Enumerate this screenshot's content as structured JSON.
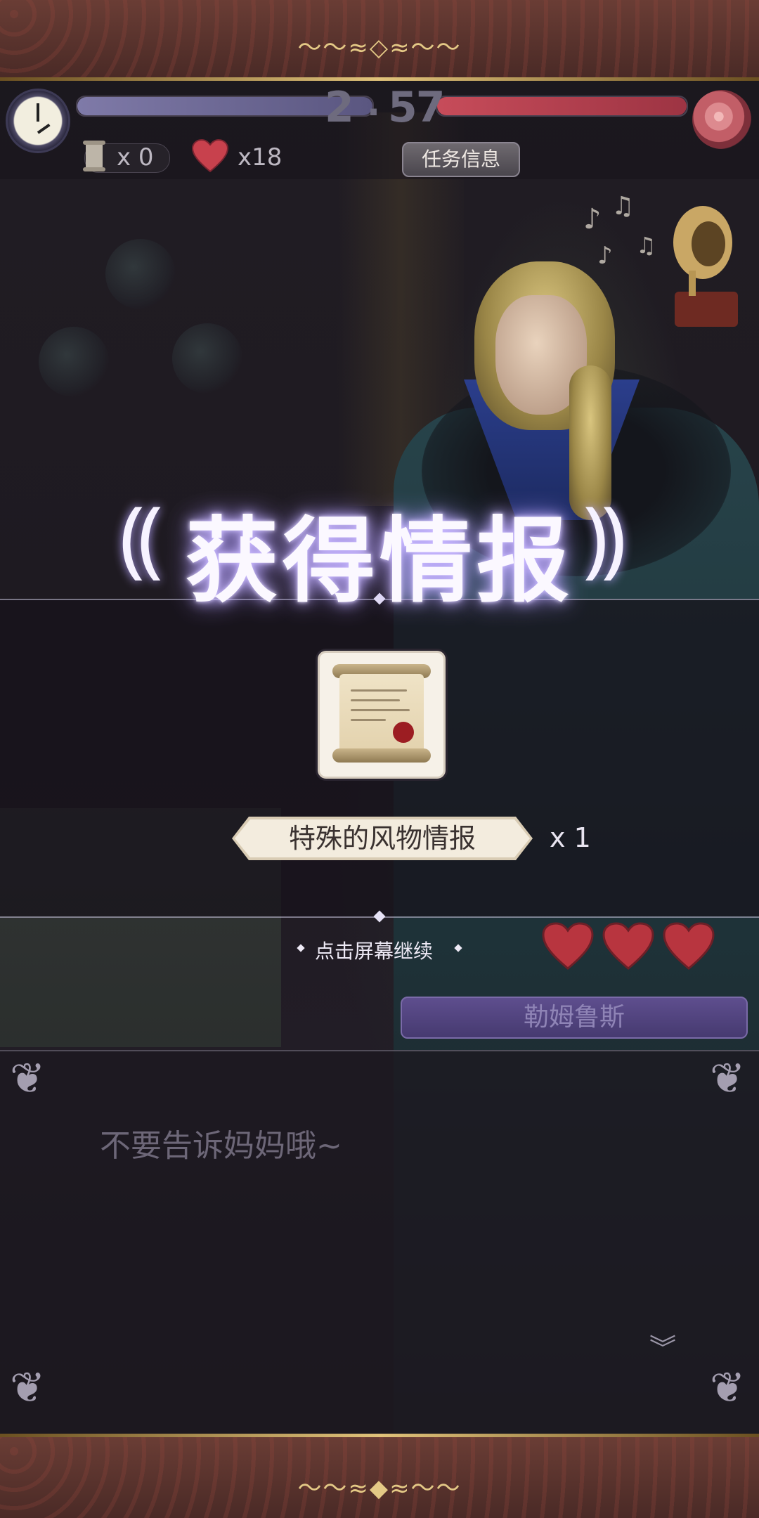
{
  "hud": {
    "time_hours": "2",
    "time_minutes": "57",
    "scroll_count": "x 0",
    "heart_count": "x18",
    "mission_button": "任务信息"
  },
  "reward": {
    "title": "获得情报",
    "item_name": "特殊的风物情报",
    "quantity": "x 1",
    "continue_hint": "点击屏幕继续"
  },
  "affection": {
    "hearts_filled": 3,
    "hearts_total": 3
  },
  "speaker": {
    "name": "勒姆鲁斯"
  },
  "dialogue": {
    "text": "不要告诉妈妈哦~"
  },
  "colors": {
    "accent_gold": "#e0c27a",
    "heart_red": "#c8414d",
    "title_glow": "#c9b8ff",
    "time_bar_right": "#c74c5a"
  },
  "icons": {
    "clock": "clock-icon",
    "rose": "rose-icon",
    "scroll": "scroll-icon",
    "heart": "heart-icon",
    "gramophone": "gramophone-icon",
    "laurel": "laurel-icon",
    "next": "double-chevron-down-icon"
  }
}
